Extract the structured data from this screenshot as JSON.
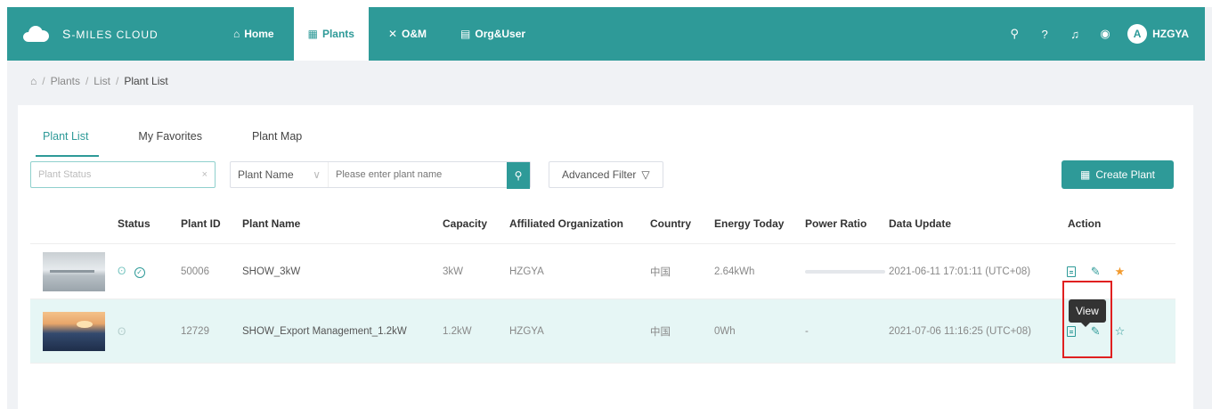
{
  "brand": {
    "name_prefix": "S",
    "name_rest": "-MILES CLOUD"
  },
  "nav": [
    {
      "label": "Home",
      "icon": "home-icon",
      "glyph": "⌂",
      "active": false
    },
    {
      "label": "Plants",
      "icon": "plants-icon",
      "glyph": "▦",
      "active": true
    },
    {
      "label": "O&M",
      "icon": "tools-icon",
      "glyph": "✕",
      "active": false
    },
    {
      "label": "Org&User",
      "icon": "org-icon",
      "glyph": "▤",
      "active": false
    }
  ],
  "header_right": {
    "icons": [
      {
        "name": "search-icon",
        "glyph": "⚲"
      },
      {
        "name": "help-icon",
        "glyph": "?"
      },
      {
        "name": "bell-icon",
        "glyph": "♫"
      },
      {
        "name": "globe-icon",
        "glyph": "◉"
      }
    ],
    "avatar_letter": "A",
    "username": "HZGYA"
  },
  "breadcrumb": {
    "home_icon": "⌂",
    "items": [
      "Plants",
      "List",
      "Plant List"
    ],
    "separator": "/"
  },
  "tabs": [
    {
      "label": "Plant List",
      "active": true
    },
    {
      "label": "My Favorites",
      "active": false
    },
    {
      "label": "Plant Map",
      "active": false
    }
  ],
  "filters": {
    "status_placeholder": "Plant Status",
    "status_clear": "×",
    "field_select": "Plant Name",
    "field_chevron": "∨",
    "search_placeholder": "Please enter plant name",
    "search_icon": "⚲",
    "advanced_label": "Advanced Filter",
    "advanced_icon": "▽",
    "create_label": "Create Plant",
    "create_icon": "▦"
  },
  "table": {
    "headers": [
      "Status",
      "Plant ID",
      "Plant Name",
      "Capacity",
      "Affiliated Organization",
      "Country",
      "Energy Today",
      "Power Ratio",
      "Data Update",
      "Action"
    ],
    "rows": [
      {
        "status_icon": "ʘ",
        "status_ok": "✓",
        "plant_id": "50006",
        "plant_name": "SHOW_3kW",
        "capacity": "3kW",
        "organization": "HZGYA",
        "country": "中国",
        "energy_today": "2.64kWh",
        "power_ratio": "",
        "data_update": "2021-06-11 17:01:11 (UTC+08)",
        "favorite": "★"
      },
      {
        "status_icon": "ʘ",
        "status_ok": "",
        "plant_id": "12729",
        "plant_name": "SHOW_Export Management_1.2kW",
        "capacity": "1.2kW",
        "organization": "HZGYA",
        "country": "中国",
        "energy_today": "0Wh",
        "power_ratio": "-",
        "data_update": "2021-07-06 11:16:25 (UTC+08)",
        "favorite": "☆"
      }
    ],
    "edit_glyph": "✎"
  },
  "tooltip": {
    "text": "View"
  },
  "colors": {
    "brand": "#2e9a98",
    "star": "#f29a2e",
    "highlight": "#e02020"
  }
}
